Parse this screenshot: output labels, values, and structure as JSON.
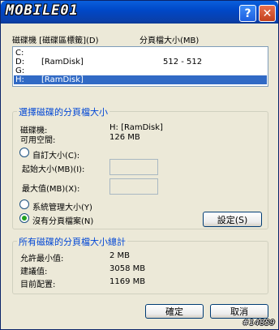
{
  "window": {
    "title": "MOBILE01",
    "help_label": "?",
    "close_label": "✕"
  },
  "drives_header": {
    "drive_col": "磁碟機 [磁碟區標籤](D)",
    "size_col": "分頁檔大小(MB)"
  },
  "drives": [
    {
      "drive": "C:",
      "label": "",
      "size": "",
      "selected": false
    },
    {
      "drive": "D:",
      "label": "[RamDisk]",
      "size": "512 - 512",
      "selected": false
    },
    {
      "drive": "G:",
      "label": "",
      "size": "",
      "selected": false
    },
    {
      "drive": "H:",
      "label": "[RamDisk]",
      "size": "",
      "selected": true
    }
  ],
  "selected_group": {
    "title": "選擇磁碟的分頁檔大小",
    "drive_label": "磁碟機:",
    "drive_value": "H:  [RamDisk]",
    "space_label": "可用空間:",
    "space_value": "126 MB",
    "custom_size": "自訂大小(C):",
    "initial_size": "起始大小(MB)(I):",
    "max_size": "最大值(MB)(X):",
    "system_managed": "系統管理大小(Y)",
    "no_paging": "沒有分頁檔案(N)",
    "set_button": "設定(S)",
    "selected_option": "no_paging"
  },
  "totals_group": {
    "title": "所有磁碟的分頁檔大小總計",
    "min_label": "允許最小值:",
    "min_value": "2 MB",
    "recommended_label": "建議值:",
    "recommended_value": "3058 MB",
    "current_label": "目前配置:",
    "current_value": "1169 MB"
  },
  "footer": {
    "ok_button": "確定",
    "cancel_button": "取消",
    "watermark": "#14859"
  }
}
